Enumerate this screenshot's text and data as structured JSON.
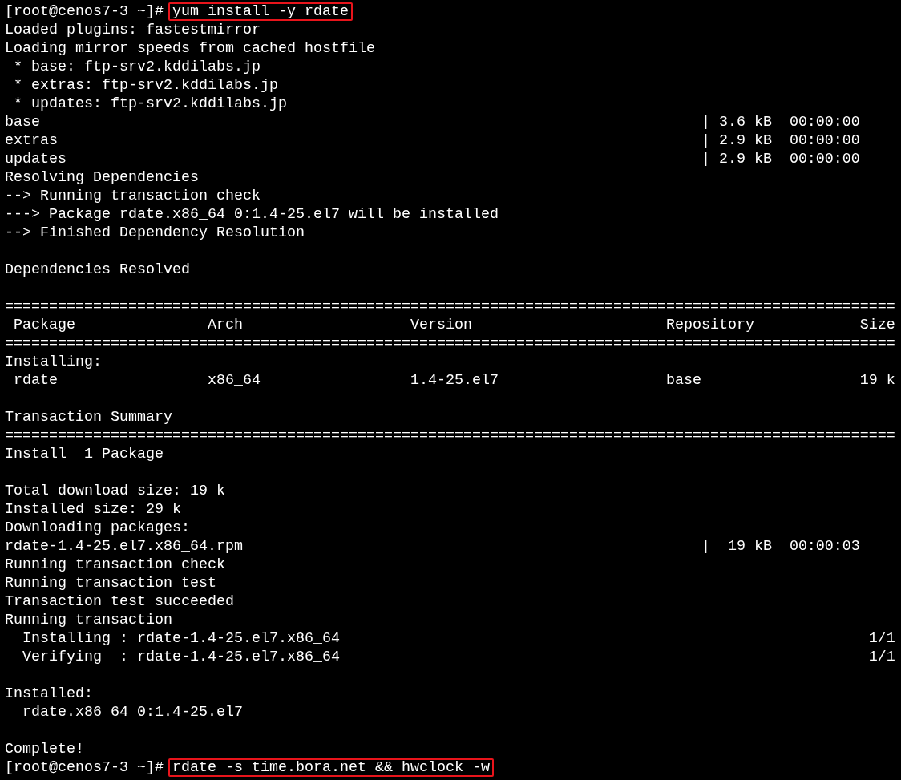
{
  "terminal": {
    "lines": [
      {
        "kind": "prompt",
        "prompt": "[root@cenos7-3 ~]#",
        "command": "yum install -y rdate",
        "highlighted": true
      },
      {
        "kind": "text",
        "text": "Loaded plugins: fastestmirror"
      },
      {
        "kind": "text",
        "text": "Loading mirror speeds from cached hostfile"
      },
      {
        "kind": "text",
        "text": " * base: ftp-srv2.kddilabs.jp"
      },
      {
        "kind": "text",
        "text": " * extras: ftp-srv2.kddilabs.jp"
      },
      {
        "kind": "text",
        "text": " * updates: ftp-srv2.kddilabs.jp"
      },
      {
        "kind": "transfer",
        "name": "base",
        "info": "| 3.6 kB  00:00:00"
      },
      {
        "kind": "transfer",
        "name": "extras",
        "info": "| 2.9 kB  00:00:00"
      },
      {
        "kind": "transfer",
        "name": "updates",
        "info": "| 2.9 kB  00:00:00"
      },
      {
        "kind": "text",
        "text": "Resolving Dependencies"
      },
      {
        "kind": "text",
        "text": "--> Running transaction check"
      },
      {
        "kind": "text",
        "text": "---> Package rdate.x86_64 0:1.4-25.el7 will be installed"
      },
      {
        "kind": "text",
        "text": "--> Finished Dependency Resolution"
      },
      {
        "kind": "blank"
      },
      {
        "kind": "text",
        "text": "Dependencies Resolved"
      },
      {
        "kind": "blank"
      },
      {
        "kind": "rule",
        "text": "====================================================================================================="
      },
      {
        "kind": "table_header",
        "cells": [
          "Package",
          "Arch",
          "Version",
          "Repository",
          "Size"
        ]
      },
      {
        "kind": "rule",
        "text": "====================================================================================================="
      },
      {
        "kind": "text",
        "text": "Installing:"
      },
      {
        "kind": "table_row",
        "cells": [
          "rdate",
          "x86_64",
          "1.4-25.el7",
          "base",
          "19 k"
        ]
      },
      {
        "kind": "blank"
      },
      {
        "kind": "text",
        "text": "Transaction Summary"
      },
      {
        "kind": "rule",
        "text": "====================================================================================================="
      },
      {
        "kind": "text",
        "text": "Install  1 Package"
      },
      {
        "kind": "blank"
      },
      {
        "kind": "text",
        "text": "Total download size: 19 k"
      },
      {
        "kind": "text",
        "text": "Installed size: 29 k"
      },
      {
        "kind": "text",
        "text": "Downloading packages:"
      },
      {
        "kind": "transfer",
        "name": "rdate-1.4-25.el7.x86_64.rpm",
        "info": "|  19 kB  00:00:03"
      },
      {
        "kind": "text",
        "text": "Running transaction check"
      },
      {
        "kind": "text",
        "text": "Running transaction test"
      },
      {
        "kind": "text",
        "text": "Transaction test succeeded"
      },
      {
        "kind": "text",
        "text": "Running transaction"
      },
      {
        "kind": "counter",
        "text": "  Installing : rdate-1.4-25.el7.x86_64",
        "count": "1/1"
      },
      {
        "kind": "counter",
        "text": "  Verifying  : rdate-1.4-25.el7.x86_64",
        "count": "1/1"
      },
      {
        "kind": "blank"
      },
      {
        "kind": "text",
        "text": "Installed:"
      },
      {
        "kind": "text",
        "text": "  rdate.x86_64 0:1.4-25.el7"
      },
      {
        "kind": "blank"
      },
      {
        "kind": "text",
        "text": "Complete!"
      },
      {
        "kind": "prompt",
        "prompt": "[root@cenos7-3 ~]#",
        "command": "rdate -s time.bora.net && hwclock -w",
        "highlighted": true
      }
    ]
  }
}
